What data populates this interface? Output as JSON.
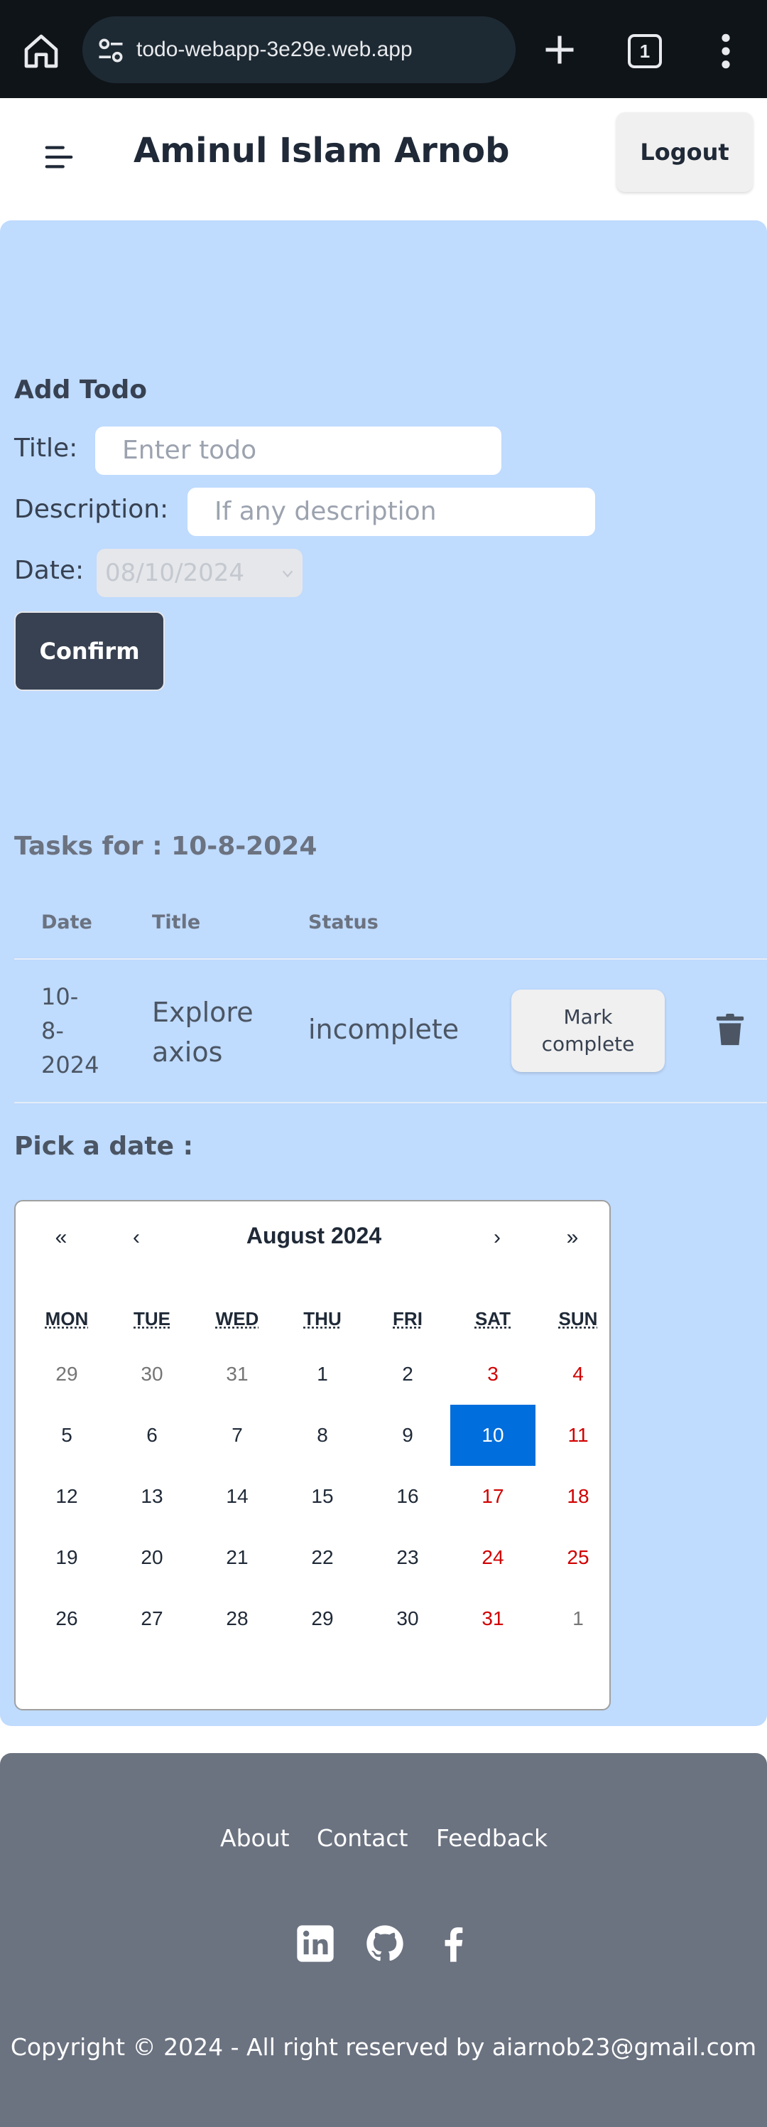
{
  "browser": {
    "url": "todo-webapp-3e29e.web.app",
    "tab_count": "1"
  },
  "header": {
    "user_name": "Aminul Islam Arnob",
    "logout_label": "Logout"
  },
  "form": {
    "heading": "Add Todo",
    "title_label": "Title:",
    "title_placeholder": "Enter todo",
    "description_label": "Description:",
    "description_placeholder": "If any description",
    "date_label": "Date:",
    "date_value": "08/10/2024",
    "confirm_label": "Confirm"
  },
  "tasks": {
    "heading": "Tasks for : 10-8-2024",
    "columns": [
      "Date",
      "Title",
      "Status"
    ],
    "rows": [
      {
        "date_lines": [
          "10-",
          "8-",
          "2024"
        ],
        "title_lines": [
          "Explore",
          "axios"
        ],
        "status": "incomplete",
        "action_lines": [
          "Mark",
          "complete"
        ]
      }
    ]
  },
  "picker": {
    "heading": "Pick a date :",
    "nav": {
      "prev_year": "«",
      "prev_month": "‹",
      "next_month": "›",
      "next_year": "»"
    },
    "month_label": "August 2024",
    "weekdays": [
      "MON",
      "TUE",
      "WED",
      "THU",
      "FRI",
      "SAT",
      "SUN"
    ],
    "weeks": [
      [
        "29",
        "30",
        "31",
        "1",
        "2",
        "3",
        "4"
      ],
      [
        "5",
        "6",
        "7",
        "8",
        "9",
        "10",
        "11"
      ],
      [
        "12",
        "13",
        "14",
        "15",
        "16",
        "17",
        "18"
      ],
      [
        "19",
        "20",
        "21",
        "22",
        "23",
        "24",
        "25"
      ],
      [
        "26",
        "27",
        "28",
        "29",
        "30",
        "31",
        "1"
      ]
    ],
    "selected_day": "10",
    "colors": {
      "selected": "#006edc",
      "weekend": "#d10000",
      "other_month": "#757575"
    }
  },
  "footer": {
    "links": [
      "About",
      "Contact",
      "Feedback"
    ],
    "social_icons": [
      "linkedin-icon",
      "github-icon",
      "facebook-icon"
    ],
    "copyright": "Copyright © 2024 - All right reserved by aiarnob23@gmail.com"
  },
  "colors": {
    "chrome_bg": "#0f1419",
    "panel_bg": "#bfdbfe",
    "confirm_bg": "#374151",
    "footer_bg": "#6b7280"
  }
}
